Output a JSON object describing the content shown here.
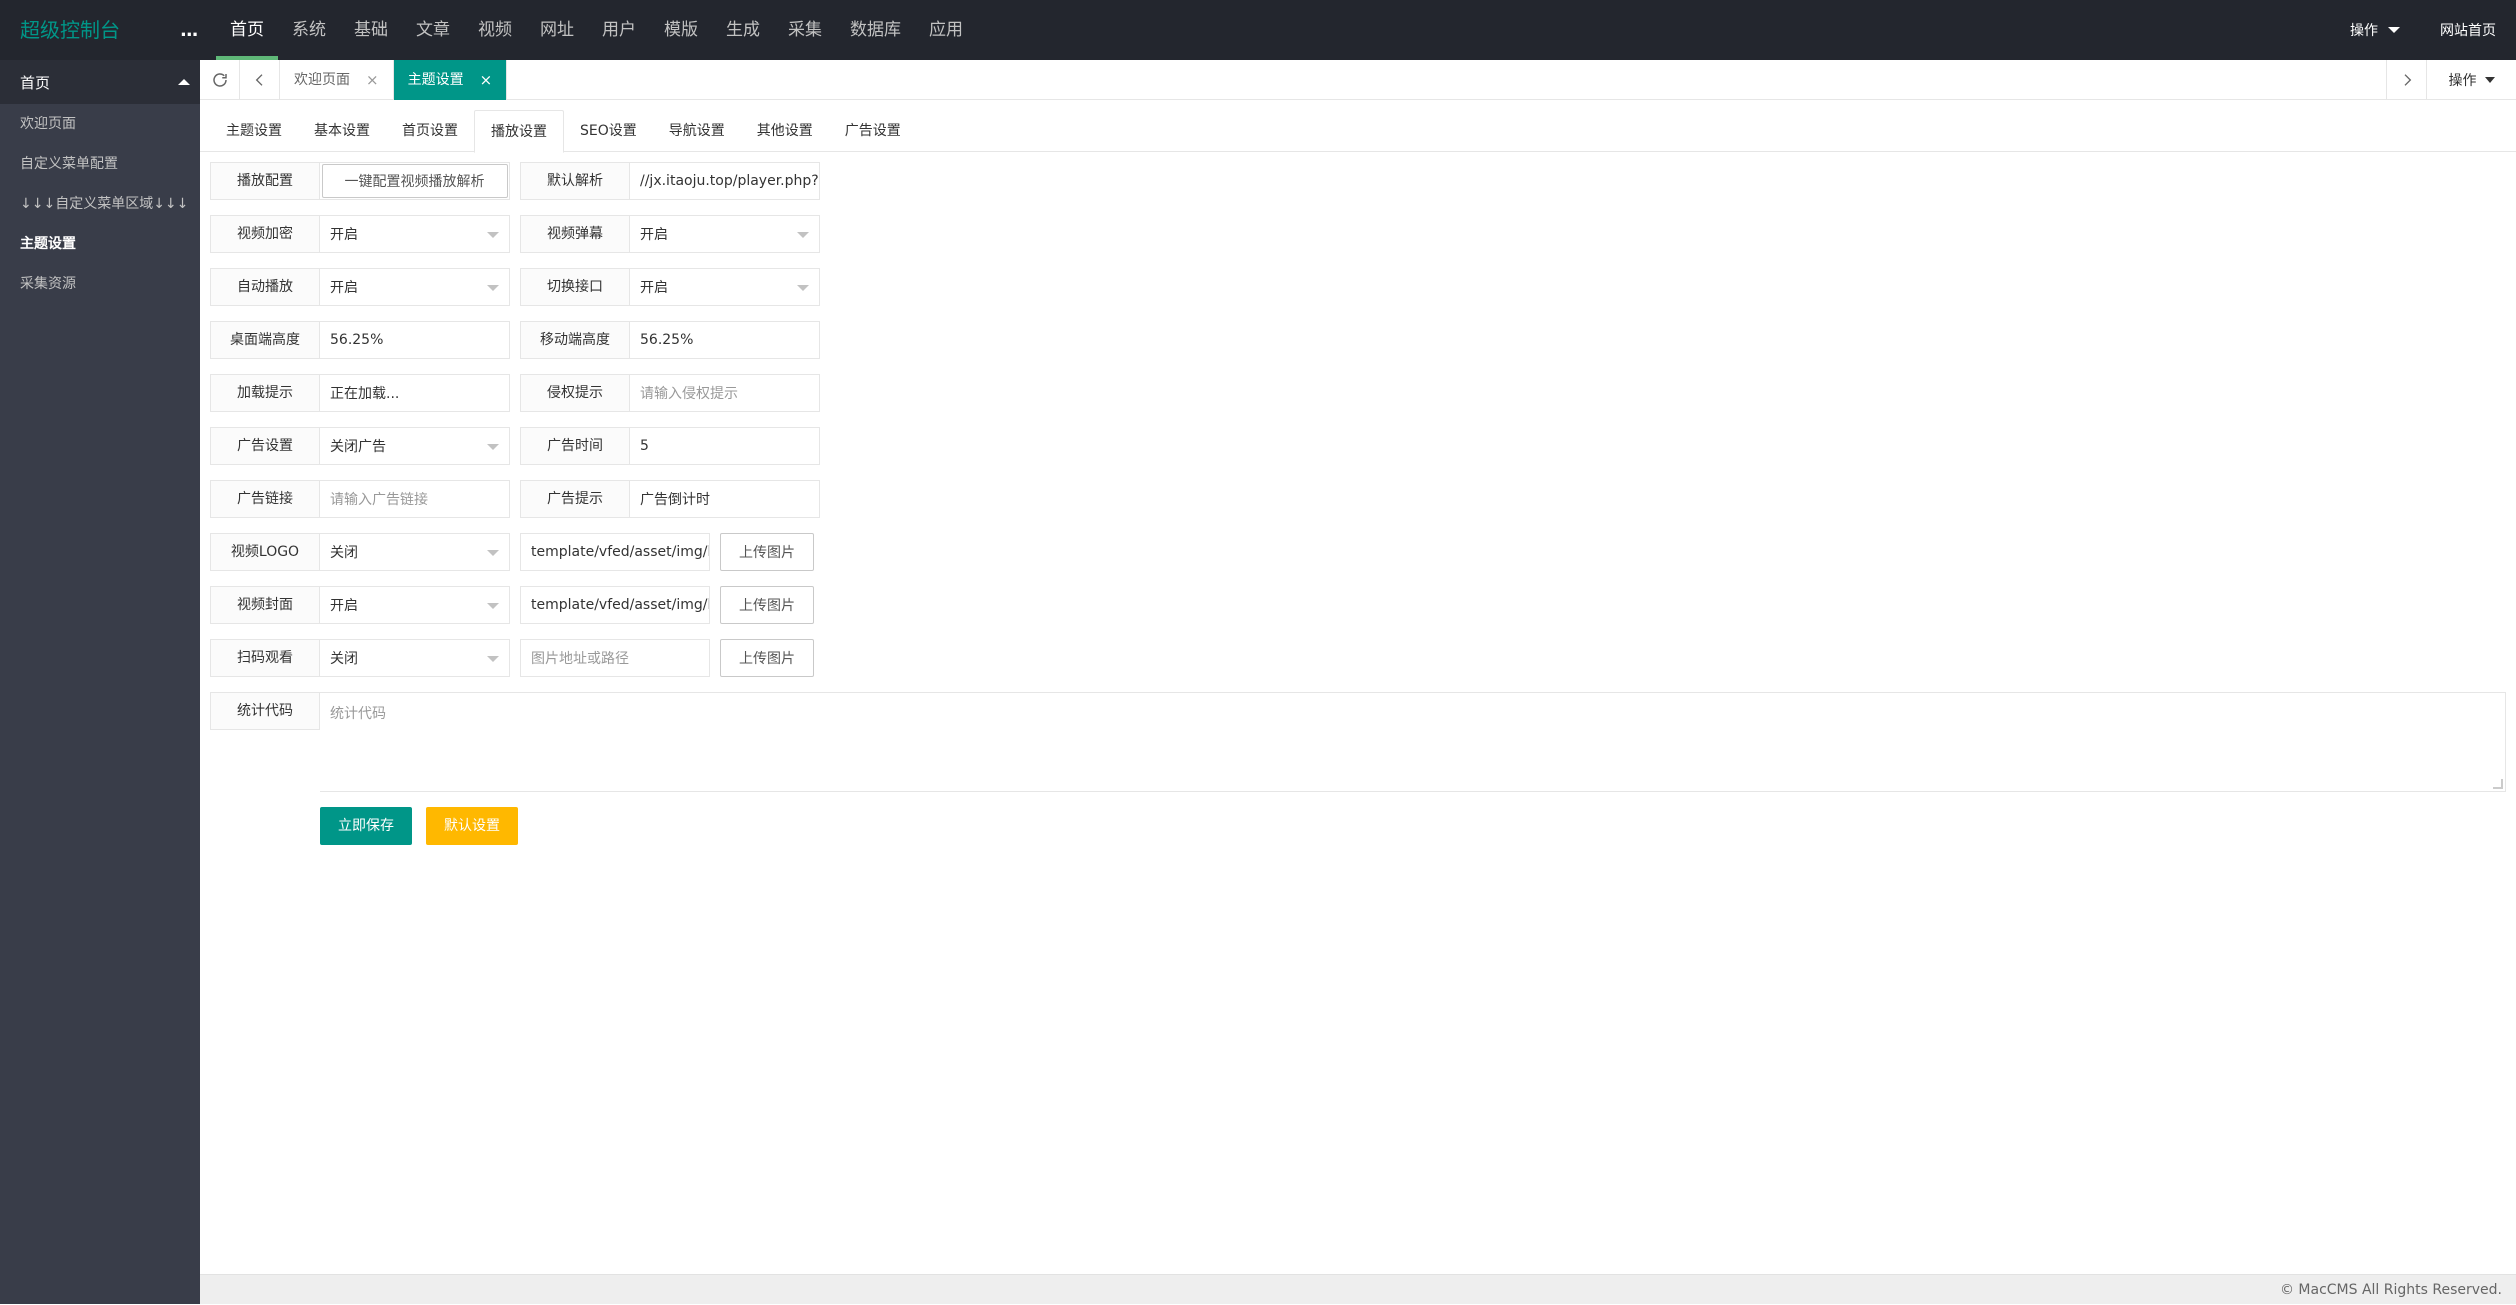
{
  "header": {
    "logo": "超级控制台",
    "toggle": "...",
    "nav": [
      "首页",
      "系统",
      "基础",
      "文章",
      "视频",
      "网址",
      "用户",
      "模版",
      "生成",
      "采集",
      "数据库",
      "应用"
    ],
    "active_nav": "首页",
    "right": {
      "ops_label": "操作",
      "home_label": "网站首页"
    }
  },
  "sidebar": {
    "head": "首页",
    "items": [
      "欢迎页面",
      "自定义菜单配置",
      "↓↓↓自定义菜单区域↓↓↓",
      "主题设置",
      "采集资源"
    ],
    "active_item": "主题设置"
  },
  "tabbar": {
    "tabs": [
      {
        "label": "欢迎页面",
        "close": "×"
      },
      {
        "label": "主题设置",
        "close": "×"
      }
    ],
    "ops_label": "操作"
  },
  "settings_tabs": [
    "主题设置",
    "基本设置",
    "首页设置",
    "播放设置",
    "SEO设置",
    "导航设置",
    "其他设置",
    "广告设置"
  ],
  "active_settings_tab": "播放设置",
  "form": {
    "play_config": {
      "label": "播放配置",
      "button": "一键配置视频播放解析"
    },
    "default_parse": {
      "label": "默认解析",
      "value": "//jx.itaoju.top/player.php?url="
    },
    "video_encrypt": {
      "label": "视频加密",
      "value": "开启"
    },
    "video_danmaku": {
      "label": "视频弹幕",
      "value": "开启"
    },
    "autoplay": {
      "label": "自动播放",
      "value": "开启"
    },
    "switch_api": {
      "label": "切换接口",
      "value": "开启"
    },
    "desktop_height": {
      "label": "桌面端高度",
      "value": "56.25%"
    },
    "mobile_height": {
      "label": "移动端高度",
      "value": "56.25%"
    },
    "loading_tip": {
      "label": "加载提示",
      "value": "正在加载..."
    },
    "copyright_tip": {
      "label": "侵权提示",
      "placeholder": "请输入侵权提示"
    },
    "ad_setting": {
      "label": "广告设置",
      "value": "关闭广告"
    },
    "ad_time": {
      "label": "广告时间",
      "value": "5"
    },
    "ad_link": {
      "label": "广告链接",
      "placeholder": "请输入广告链接"
    },
    "ad_tip": {
      "label": "广告提示",
      "value": "广告倒计时"
    },
    "video_logo": {
      "label": "视频LOGO",
      "value": "关闭",
      "path": "template/vfed/asset/img/logo",
      "upload": "上传图片"
    },
    "video_cover": {
      "label": "视频封面",
      "value": "开启",
      "path": "template/vfed/asset/img/load",
      "upload": "上传图片"
    },
    "qr_watch": {
      "label": "扫码观看",
      "value": "关闭",
      "path_placeholder": "图片地址或路径",
      "upload": "上传图片"
    },
    "stats_code": {
      "label": "统计代码",
      "placeholder": "统计代码"
    }
  },
  "actions": {
    "save": "立即保存",
    "default": "默认设置"
  },
  "footer": {
    "copyright": "© MacCMS All Rights Reserved."
  },
  "colors": {
    "header_bg": "#23262e",
    "sidebar_bg": "#393d49",
    "accent_green": "#009688",
    "nav_underline": "#5fb878",
    "warn_orange": "#ffb800"
  }
}
